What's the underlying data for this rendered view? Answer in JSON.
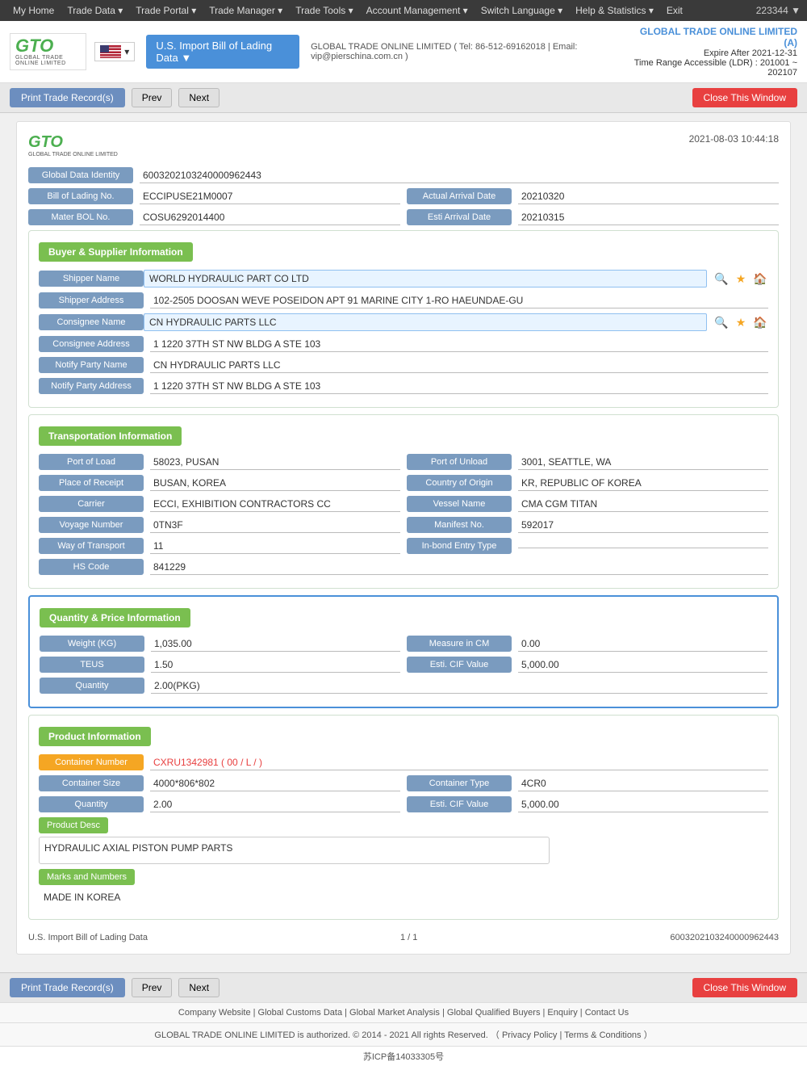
{
  "topnav": {
    "items": [
      "My Home",
      "Trade Data",
      "Trade Portal",
      "Trade Manager",
      "Trade Tools",
      "Account Management",
      "Switch Language",
      "Help & Statistics",
      "Exit"
    ],
    "user_id": "223344 ▼"
  },
  "header": {
    "logo_main": "GTO",
    "logo_sub": "GLOBAL TRADE ONLINE LIMITED",
    "db_selector": "U.S. Import Bill of Lading Data ▼",
    "contact": "GLOBAL TRADE ONLINE LIMITED ( Tel: 86-512-69162018 | Email: vip@pierschina.com.cn )",
    "company_name": "GLOBAL TRADE ONLINE LIMITED (A)",
    "expire_label": "Expire After 2021-12-31",
    "time_range": "Time Range Accessible (LDR) : 201001 ~ 202107"
  },
  "toolbar": {
    "print_label": "Print Trade Record(s)",
    "prev_label": "Prev",
    "next_label": "Next",
    "close_label": "Close This Window"
  },
  "record": {
    "logo_main": "GTO",
    "logo_sub": "GLOBAL TRADE ONLINE LIMITED",
    "timestamp": "2021-08-03 10:44:18",
    "global_data_identity_label": "Global Data Identity",
    "global_data_identity_value": "6003202103240000962443",
    "bol_no_label": "Bill of Lading No.",
    "bol_no_value": "ECCIPUSE21M0007",
    "actual_arrival_label": "Actual Arrival Date",
    "actual_arrival_value": "20210320",
    "mater_bol_label": "Mater BOL No.",
    "mater_bol_value": "COSU6292014400",
    "esti_arrival_label": "Esti Arrival Date",
    "esti_arrival_value": "20210315"
  },
  "buyer_supplier": {
    "section_title": "Buyer & Supplier Information",
    "shipper_name_label": "Shipper Name",
    "shipper_name_value": "WORLD HYDRAULIC PART CO LTD",
    "shipper_address_label": "Shipper Address",
    "shipper_address_value": "102-2505 DOOSAN WEVE POSEIDON APT 91 MARINE CITY 1-RO HAEUNDAE-GU",
    "consignee_name_label": "Consignee Name",
    "consignee_name_value": "CN HYDRAULIC PARTS LLC",
    "consignee_address_label": "Consignee Address",
    "consignee_address_value": "1 1220 37TH ST NW BLDG A STE 103",
    "notify_party_name_label": "Notify Party Name",
    "notify_party_name_value": "CN HYDRAULIC PARTS LLC",
    "notify_party_address_label": "Notify Party Address",
    "notify_party_address_value": "1 1220 37TH ST NW BLDG A STE 103"
  },
  "transportation": {
    "section_title": "Transportation Information",
    "port_of_load_label": "Port of Load",
    "port_of_load_value": "58023, PUSAN",
    "port_of_unload_label": "Port of Unload",
    "port_of_unload_value": "3001, SEATTLE, WA",
    "place_of_receipt_label": "Place of Receipt",
    "place_of_receipt_value": "BUSAN, KOREA",
    "country_of_origin_label": "Country of Origin",
    "country_of_origin_value": "KR, REPUBLIC OF KOREA",
    "carrier_label": "Carrier",
    "carrier_value": "ECCI, EXHIBITION CONTRACTORS CC",
    "vessel_name_label": "Vessel Name",
    "vessel_name_value": "CMA CGM TITAN",
    "voyage_number_label": "Voyage Number",
    "voyage_number_value": "0TN3F",
    "manifest_no_label": "Manifest No.",
    "manifest_no_value": "592017",
    "way_of_transport_label": "Way of Transport",
    "way_of_transport_value": "11",
    "in_bond_entry_label": "In-bond Entry Type",
    "in_bond_entry_value": "",
    "hs_code_label": "HS Code",
    "hs_code_value": "841229"
  },
  "quantity_price": {
    "section_title": "Quantity & Price Information",
    "weight_label": "Weight (KG)",
    "weight_value": "1,035.00",
    "measure_in_cm_label": "Measure in CM",
    "measure_in_cm_value": "0.00",
    "teus_label": "TEUS",
    "teus_value": "1.50",
    "esti_cif_label": "Esti. CIF Value",
    "esti_cif_value": "5,000.00",
    "quantity_label": "Quantity",
    "quantity_value": "2.00(PKG)"
  },
  "product": {
    "section_title": "Product Information",
    "container_number_label": "Container Number",
    "container_number_value": "CXRU1342981 ( 00 / L / )",
    "container_size_label": "Container Size",
    "container_size_value": "4000*806*802",
    "container_type_label": "Container Type",
    "container_type_value": "4CR0",
    "quantity_label": "Quantity",
    "quantity_value": "2.00",
    "esti_cif_label": "Esti. CIF Value",
    "esti_cif_value": "5,000.00",
    "product_desc_label": "Product Desc",
    "product_desc_value": "HYDRAULIC AXIAL PISTON PUMP PARTS",
    "marks_numbers_label": "Marks and Numbers",
    "marks_numbers_value": "MADE IN KOREA"
  },
  "record_footer": {
    "db_label": "U.S. Import Bill of Lading Data",
    "page_info": "1 / 1",
    "record_id": "6003202103240000962443"
  },
  "footer": {
    "links": "Company Website | Global Customs Data | Global Market Analysis | Global Qualified Buyers | Enquiry | Contact Us",
    "copyright": "GLOBAL TRADE ONLINE LIMITED is authorized. © 2014 - 2021 All rights Reserved.  （ Privacy Policy | Terms & Conditions ）",
    "icp": "苏ICP备14033305号"
  }
}
